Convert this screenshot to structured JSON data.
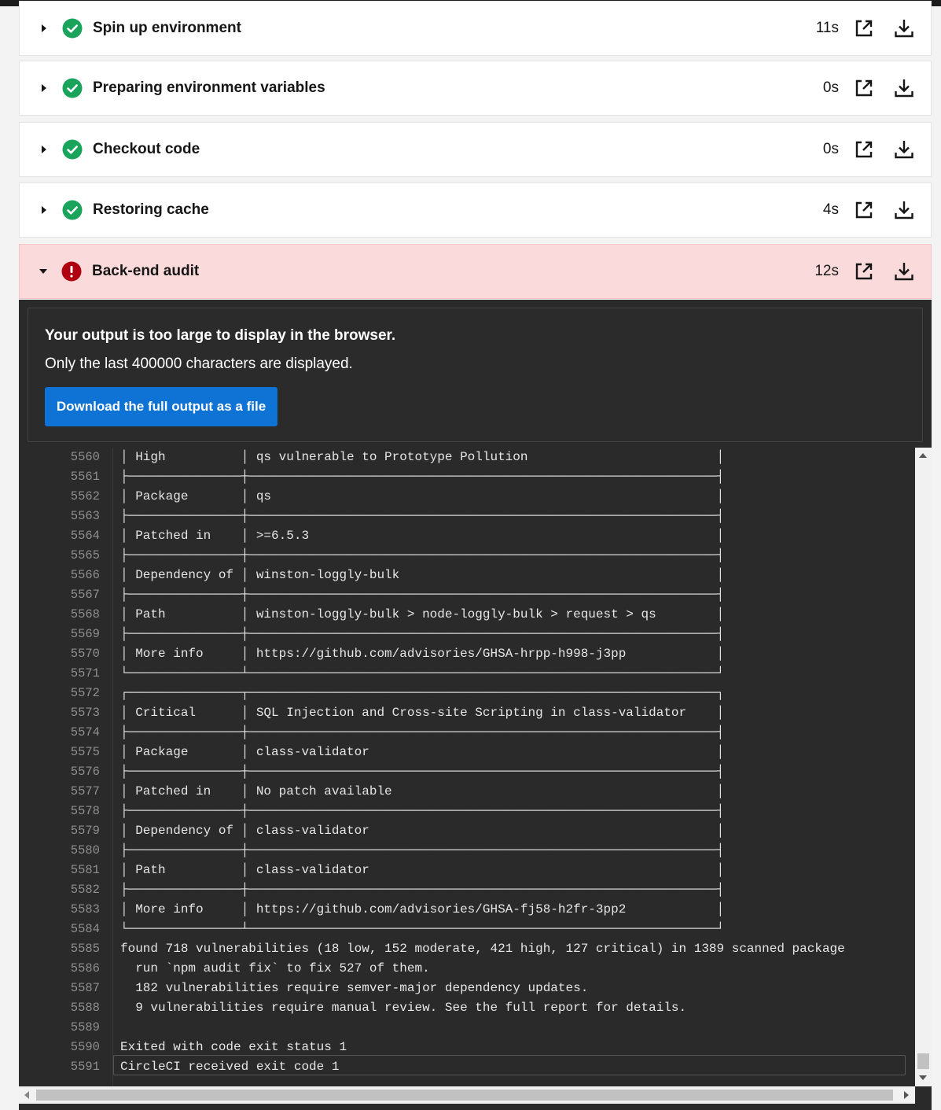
{
  "steps": [
    {
      "name": "Spin up environment",
      "duration": "11s",
      "status": "success"
    },
    {
      "name": "Preparing environment variables",
      "duration": "0s",
      "status": "success"
    },
    {
      "name": "Checkout code",
      "duration": "0s",
      "status": "success"
    },
    {
      "name": "Restoring cache",
      "duration": "4s",
      "status": "success"
    },
    {
      "name": "Back-end audit",
      "duration": "12s",
      "status": "failed"
    }
  ],
  "colors": {
    "success": "#1aa35a",
    "failed": "#b00010",
    "accent": "#0f73d6"
  },
  "notice": {
    "title": "Your output is too large to display in the browser.",
    "subtitle": "Only the last 400000 characters are displayed.",
    "download_label": "Download the full output as a file"
  },
  "log": [
    {
      "n": "5560",
      "t": "│ High          │ qs vulnerable to Prototype Pollution                         │"
    },
    {
      "n": "5561",
      "t": "├───────────────┼──────────────────────────────────────────────────────────────┤"
    },
    {
      "n": "5562",
      "t": "│ Package       │ qs                                                           │"
    },
    {
      "n": "5563",
      "t": "├───────────────┼──────────────────────────────────────────────────────────────┤"
    },
    {
      "n": "5564",
      "t": "│ Patched in    │ >=6.5.3                                                      │"
    },
    {
      "n": "5565",
      "t": "├───────────────┼──────────────────────────────────────────────────────────────┤"
    },
    {
      "n": "5566",
      "t": "│ Dependency of │ winston-loggly-bulk                                          │"
    },
    {
      "n": "5567",
      "t": "├───────────────┼──────────────────────────────────────────────────────────────┤"
    },
    {
      "n": "5568",
      "t": "│ Path          │ winston-loggly-bulk > node-loggly-bulk > request > qs        │"
    },
    {
      "n": "5569",
      "t": "├───────────────┼──────────────────────────────────────────────────────────────┤"
    },
    {
      "n": "5570",
      "t": "│ More info     │ https://github.com/advisories/GHSA-hrpp-h998-j3pp            │"
    },
    {
      "n": "5571",
      "t": "└───────────────┴──────────────────────────────────────────────────────────────┘"
    },
    {
      "n": "5572",
      "t": "┌───────────────┬──────────────────────────────────────────────────────────────┐"
    },
    {
      "n": "5573",
      "t": "│ Critical      │ SQL Injection and Cross-site Scripting in class-validator    │"
    },
    {
      "n": "5574",
      "t": "├───────────────┼──────────────────────────────────────────────────────────────┤"
    },
    {
      "n": "5575",
      "t": "│ Package       │ class-validator                                              │"
    },
    {
      "n": "5576",
      "t": "├───────────────┼──────────────────────────────────────────────────────────────┤"
    },
    {
      "n": "5577",
      "t": "│ Patched in    │ No patch available                                           │"
    },
    {
      "n": "5578",
      "t": "├───────────────┼──────────────────────────────────────────────────────────────┤"
    },
    {
      "n": "5579",
      "t": "│ Dependency of │ class-validator                                              │"
    },
    {
      "n": "5580",
      "t": "├───────────────┼──────────────────────────────────────────────────────────────┤"
    },
    {
      "n": "5581",
      "t": "│ Path          │ class-validator                                              │"
    },
    {
      "n": "5582",
      "t": "├───────────────┼──────────────────────────────────────────────────────────────┤"
    },
    {
      "n": "5583",
      "t": "│ More info     │ https://github.com/advisories/GHSA-fj58-h2fr-3pp2            │"
    },
    {
      "n": "5584",
      "t": "└───────────────┴──────────────────────────────────────────────────────────────┘"
    },
    {
      "n": "5585",
      "t": "found 718 vulnerabilities (18 low, 152 moderate, 421 high, 127 critical) in 1389 scanned package"
    },
    {
      "n": "5586",
      "t": "  run `npm audit fix` to fix 527 of them."
    },
    {
      "n": "5587",
      "t": "  182 vulnerabilities require semver-major dependency updates."
    },
    {
      "n": "5588",
      "t": "  9 vulnerabilities require manual review. See the full report for details."
    },
    {
      "n": "5589",
      "t": ""
    },
    {
      "n": "5590",
      "t": "Exited with code exit status 1"
    },
    {
      "n": "5591",
      "t": "CircleCI received exit code 1"
    }
  ]
}
